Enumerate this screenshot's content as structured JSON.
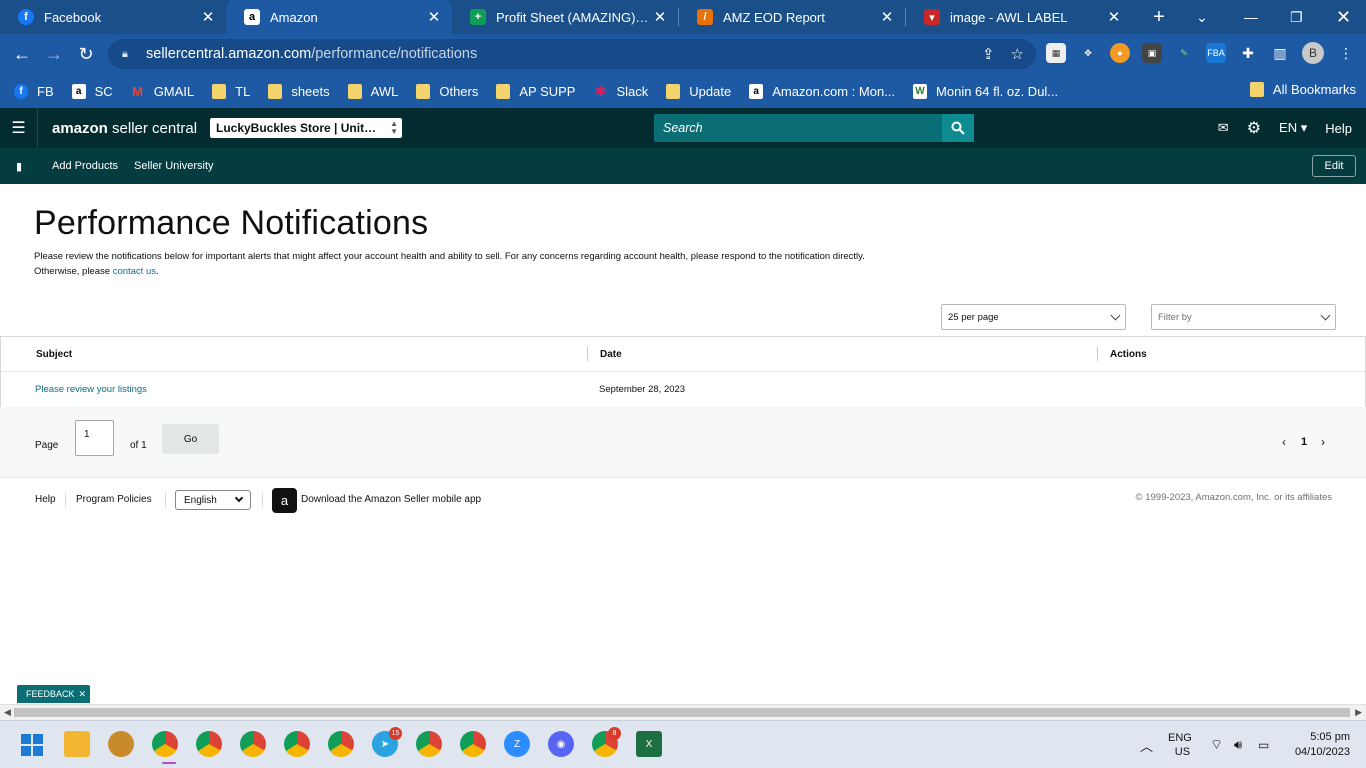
{
  "browser": {
    "tabs": [
      {
        "title": "Facebook",
        "icon": "facebook-icon",
        "color": "#1877f2",
        "active": false
      },
      {
        "title": "Amazon",
        "icon": "amazon-icon",
        "color": "#000000",
        "active": true
      },
      {
        "title": "Profit Sheet (AMAZING) - Google Sheets",
        "icon": "sheets-icon",
        "color": "#0f9d58",
        "active": false
      },
      {
        "title": "AMZ EOD Report",
        "icon": "report-icon",
        "color": "#e8710a",
        "active": false
      },
      {
        "title": "image - AWL LABEL",
        "icon": "label-icon",
        "color": "#c62828",
        "active": false
      }
    ],
    "url_host": "sellercentral.amazon.com",
    "url_path": "/performance/notifications",
    "bookmarks": [
      {
        "label": "FB",
        "icon": "facebook-icon"
      },
      {
        "label": "SC",
        "icon": "amazon-icon"
      },
      {
        "label": "GMAIL",
        "icon": "gmail-icon"
      },
      {
        "label": "TL",
        "icon": "folder-icon"
      },
      {
        "label": "sheets",
        "icon": "folder-icon"
      },
      {
        "label": "AWL",
        "icon": "folder-icon"
      },
      {
        "label": "Others",
        "icon": "folder-icon"
      },
      {
        "label": "AP SUPP",
        "icon": "folder-icon"
      },
      {
        "label": "Slack",
        "icon": "slack-icon"
      },
      {
        "label": "Update",
        "icon": "folder-icon"
      },
      {
        "label": "Amazon.com : Mon...",
        "icon": "amazon-icon"
      },
      {
        "label": "Monin 64 fl. oz. Dul...",
        "icon": "w-icon"
      }
    ],
    "all_bookmarks": "All Bookmarks",
    "profile_initial": "B"
  },
  "header": {
    "logo_bold": "amazon",
    "logo_rest": " seller central",
    "store": "LuckyBuckles Store | United States",
    "search_placeholder": "Search",
    "language": "EN",
    "help": "Help"
  },
  "subnav": {
    "links": [
      "Add Products",
      "Seller University"
    ],
    "edit": "Edit"
  },
  "main": {
    "title": "Performance Notifications",
    "intro_text": "Please review the notifications below for important alerts that might affect your account health and ability to sell. For any concerns regarding account health, please respond to the notification directly. Otherwise, please ",
    "intro_link": "contact us",
    "intro_end": ".",
    "per_page": "25 per page",
    "filter_placeholder": "Filter by",
    "columns": [
      "Subject",
      "Date",
      "Actions"
    ],
    "rows": [
      {
        "subject": "Please review your listings",
        "date": "September 28, 2023",
        "actions": ""
      }
    ],
    "pager": {
      "page_label": "Page",
      "page_value": "1",
      "of_label": "of 1",
      "go": "Go",
      "current": "1"
    }
  },
  "footer": {
    "help": "Help",
    "policies": "Program Policies",
    "language": "English",
    "app_text": "Download the Amazon Seller mobile app",
    "copyright": "© 1999-2023, Amazon.com, Inc. or its affiliates"
  },
  "feedback": "FEEDBACK",
  "taskbar": {
    "lang_top": "ENG",
    "lang_bottom": "US",
    "time": "5:05 pm",
    "date": "04/10/2023",
    "badge_telegram": "15",
    "badge_chrome": "8"
  }
}
